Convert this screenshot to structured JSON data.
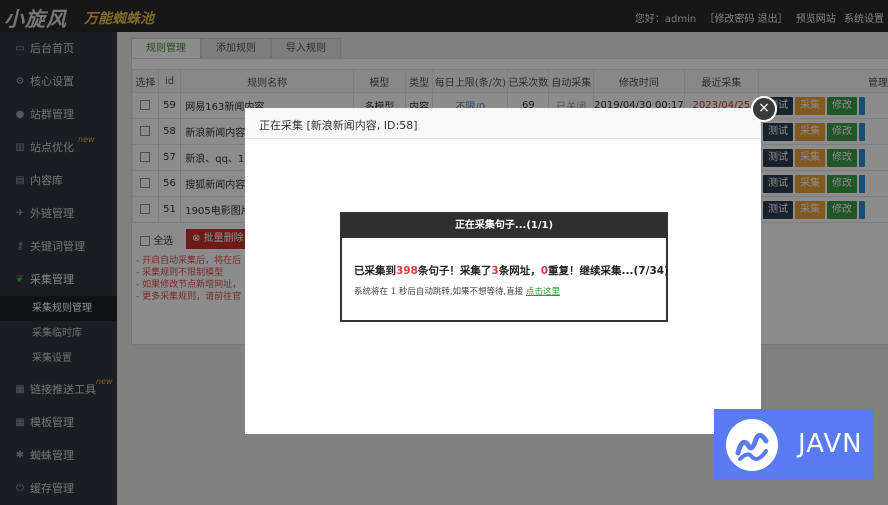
{
  "header": {
    "logo_text": "小旋风",
    "logo_sub": "万能蜘蛛池",
    "greeting": "您好：admin",
    "account_links": "［修改密码 退出］",
    "preview": "预览网站",
    "settings": "系统设置"
  },
  "sidebar": {
    "items": [
      {
        "label": "后台首页",
        "icon": "monitor-icon"
      },
      {
        "label": "核心设置",
        "icon": "gear-icon"
      },
      {
        "label": "站群管理",
        "icon": "user-icon"
      },
      {
        "label": "站点优化",
        "icon": "chart-icon",
        "badge": "new"
      },
      {
        "label": "内容库",
        "icon": "document-icon"
      },
      {
        "label": "外链管理",
        "icon": "link-icon"
      },
      {
        "label": "关键词管理",
        "icon": "key-icon"
      },
      {
        "label": "采集管理",
        "icon": "leaf-icon"
      },
      {
        "label": "链接推送工具",
        "icon": "grid-icon",
        "badge": "new"
      },
      {
        "label": "模板管理",
        "icon": "grid-icon"
      },
      {
        "label": "蜘蛛管理",
        "icon": "bug-icon"
      },
      {
        "label": "缓存管理",
        "icon": "power-icon"
      }
    ],
    "subitems": [
      "采集规则管理",
      "采集临时库",
      "采集设置"
    ]
  },
  "tabs": [
    "规则管理",
    "添加规则",
    "导入规则"
  ],
  "table": {
    "headers": [
      "选择",
      "id",
      "规则名称",
      "模型",
      "类型",
      "每日上限(条/次)",
      "已采次数",
      "自动采集",
      "修改时间",
      "最近采集",
      "管理"
    ],
    "rows": [
      {
        "id": "59",
        "name": "网易163新闻内容",
        "model": "多模型",
        "type": "内容",
        "limit": "不限/0",
        "count": "69",
        "auto": "已关闭",
        "mtime": "2019/04/30 00:17",
        "last": "2023/04/25"
      },
      {
        "id": "58",
        "name": "新浪新闻内容",
        "last_suffix": "19"
      },
      {
        "id": "57",
        "name": "新浪、qq、16",
        "last_suffix": "38"
      },
      {
        "id": "56",
        "name": "搜狐新闻内容",
        "last_suffix": "19"
      },
      {
        "id": "51",
        "name": "1905电影图片",
        "last_suffix": "17"
      }
    ],
    "actions": {
      "test": "测试",
      "collect": "采集",
      "edit": "修改"
    },
    "select_all": "全选",
    "bulk_delete": "批量删除"
  },
  "notes": [
    "- 开启自动采集后，将在后",
    "- 采集规则不限制模型",
    "- 如果修改节点新增网址，",
    "- 更多采集规则，请前往官"
  ],
  "modal": {
    "title": "正在采集 [新浪新闻内容, ID:58]",
    "close": "×",
    "dialog_title": "正在采集句子...(1/1)",
    "msg_p1": "已采集到",
    "msg_n1": "398",
    "msg_p2": "条句子！采集了",
    "msg_n2": "3",
    "msg_p3": "条网址，",
    "msg_n3": "0",
    "msg_p4": "重复！继续采集...(7/34)",
    "sub_p1": "系统将在 ",
    "sub_n": "1",
    "sub_p2": " 秒后自动跳转,如果不想等待,直接 ",
    "sub_link": "点击这里"
  },
  "watermark": {
    "text": "JAVN",
    "color": "#5a7af2"
  }
}
